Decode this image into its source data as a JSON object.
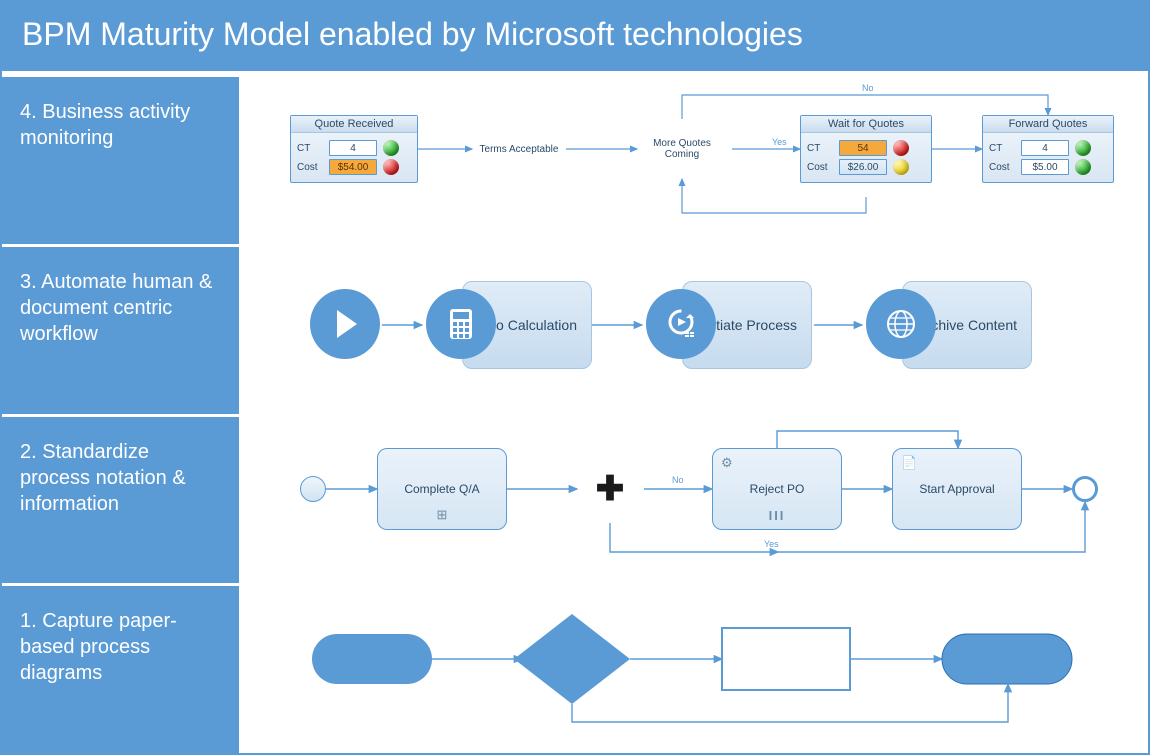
{
  "title": "BPM Maturity Model enabled by Microsoft technologies",
  "levels": {
    "l4": {
      "num": "4.",
      "text": "Business activity monitoring"
    },
    "l3": {
      "num": "3.",
      "text": "Automate human & document centric workflow"
    },
    "l2": {
      "num": "2.",
      "text": "Standardize process notation & information"
    },
    "l1": {
      "num": "1.",
      "text": "Capture paper-based process diagrams"
    }
  },
  "row4": {
    "cards": {
      "quote_received": {
        "title": "Quote Received",
        "ct": "4",
        "cost": "$54.00",
        "ct_status": "green",
        "cost_status": "red",
        "cost_box": "orange"
      },
      "wait_quotes": {
        "title": "Wait for Quotes",
        "ct": "54",
        "cost": "$26.00",
        "ct_status": "red",
        "cost_status": "yellow",
        "ct_box": "orange",
        "cost_box": "blue"
      },
      "forward_quotes": {
        "title": "Forward Quotes",
        "ct": "4",
        "cost": "$5.00",
        "ct_status": "green",
        "cost_status": "green"
      }
    },
    "diamonds": {
      "terms": "Terms Acceptable",
      "more": "More Quotes Coming"
    },
    "labels": {
      "no": "No",
      "yes": "Yes"
    }
  },
  "row3": {
    "steps": {
      "do_calc": "Do Calculation",
      "init_proc": "Intiate Process",
      "archive": "Archive Content"
    }
  },
  "row2": {
    "tasks": {
      "qa": "Complete Q/A",
      "reject": "Reject PO",
      "approval": "Start Approval"
    },
    "labels": {
      "no": "No",
      "yes": "Yes"
    },
    "icons": {
      "plus_sub": "+",
      "gear": "gear-icon",
      "script": "script-icon",
      "pause": "|||"
    }
  }
}
